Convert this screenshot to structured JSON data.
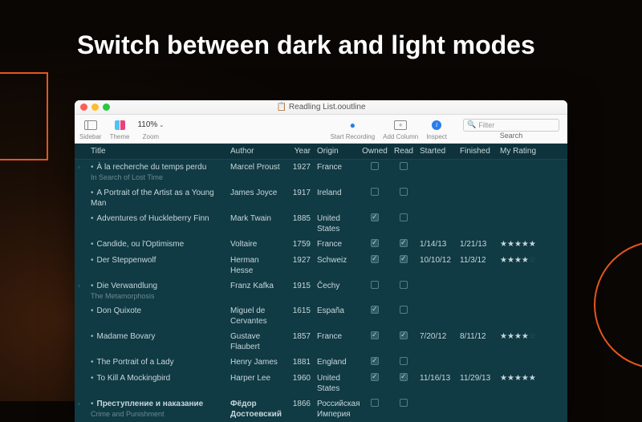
{
  "headline": "Switch between dark and light modes",
  "window": {
    "title": "Readling List.ooutline",
    "toolbar": {
      "sidebar_label": "Sidebar",
      "theme_label": "Theme",
      "zoom_label": "Zoom",
      "zoom_value": "110%",
      "start_recording_label": "Start Recording",
      "add_column_label": "Add Column",
      "inspect_label": "Inspect",
      "search_label": "Search",
      "search_placeholder": "Filter"
    }
  },
  "columns": {
    "title": "Title",
    "author": "Author",
    "year": "Year",
    "origin": "Origin",
    "owned": "Owned",
    "read": "Read",
    "started": "Started",
    "finished": "Finished",
    "rating": "My Rating"
  },
  "rows": [
    {
      "group": true,
      "title": "À la recherche du temps perdu",
      "subtitle": "In Search of Lost Time",
      "author": "Marcel Proust",
      "year": "1927",
      "origin": "France",
      "owned": false,
      "read": false,
      "started": "",
      "finished": "",
      "rating": 0
    },
    {
      "title": "A Portrait of the Artist as a Young Man",
      "author": "James Joyce",
      "year": "1917",
      "origin": "Ireland",
      "owned": false,
      "read": false,
      "started": "",
      "finished": "",
      "rating": 0
    },
    {
      "title": "Adventures of Huckleberry Finn",
      "author": "Mark Twain",
      "year": "1885",
      "origin": "United States",
      "owned": true,
      "read": false,
      "started": "",
      "finished": "",
      "rating": 0
    },
    {
      "title": "Candide, ou l'Optimisme",
      "author": "Voltaire",
      "year": "1759",
      "origin": "France",
      "owned": true,
      "read": true,
      "started": "1/14/13",
      "finished": "1/21/13",
      "rating": 5
    },
    {
      "title": "Der Steppenwolf",
      "author": "Herman Hesse",
      "year": "1927",
      "origin": "Schweiz",
      "owned": true,
      "read": true,
      "started": "10/10/12",
      "finished": "11/3/12",
      "rating": 4
    },
    {
      "group": true,
      "title": "Die Verwandlung",
      "subtitle": "The Metamorphosis",
      "author": "Franz Kafka",
      "year": "1915",
      "origin": "Čechy",
      "owned": false,
      "read": false,
      "started": "",
      "finished": "",
      "rating": 0
    },
    {
      "title": "Don Quixote",
      "author": "Miguel de Cervantes",
      "year": "1615",
      "origin": "España",
      "owned": true,
      "read": false,
      "started": "",
      "finished": "",
      "rating": 0
    },
    {
      "title": "Madame Bovary",
      "author": "Gustave Flaubert",
      "year": "1857",
      "origin": "France",
      "owned": true,
      "read": true,
      "started": "7/20/12",
      "finished": "8/11/12",
      "rating": 4
    },
    {
      "title": "The Portrait of a Lady",
      "author": "Henry James",
      "year": "1881",
      "origin": "England",
      "owned": true,
      "read": false,
      "started": "",
      "finished": "",
      "rating": 0
    },
    {
      "title": "To Kill A Mockingbird",
      "author": "Harper Lee",
      "year": "1960",
      "origin": "United States",
      "owned": true,
      "read": true,
      "started": "11/16/13",
      "finished": "11/29/13",
      "rating": 5
    },
    {
      "group": true,
      "bold": true,
      "title": "Преступление и наказание",
      "subtitle": "Crime and Punishment",
      "author": "Фёдор Достоевский",
      "year": "1866",
      "origin": "Российская Империя",
      "owned": false,
      "read": false,
      "started": "",
      "finished": "",
      "rating": 0
    }
  ]
}
